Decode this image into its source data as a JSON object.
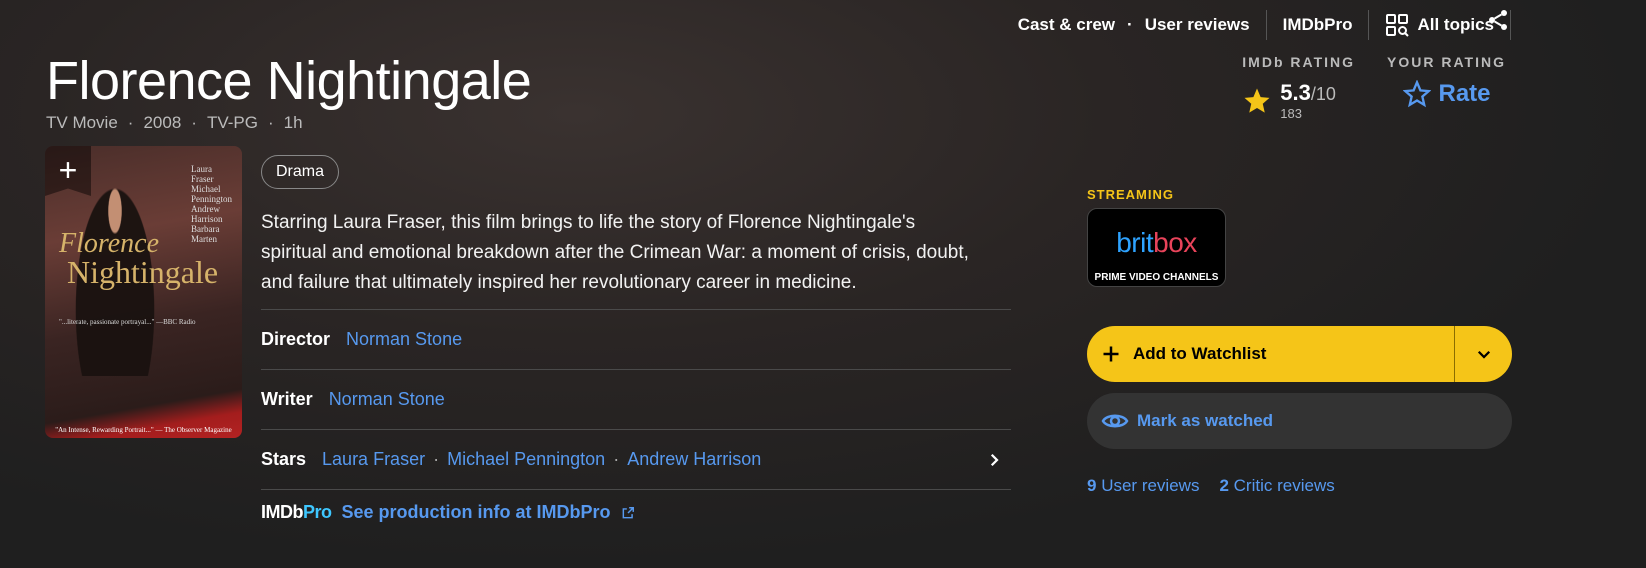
{
  "nav": {
    "cast_crew": "Cast & crew",
    "user_reviews": "User reviews",
    "imdbpro": "IMDbPro",
    "all_topics": "All topics"
  },
  "title": "Florence Nightingale",
  "meta": [
    "TV Movie",
    "2008",
    "TV-PG",
    "1h"
  ],
  "rating": {
    "imdb_label": "IMDb RATING",
    "score": "5.3",
    "out_of": "/10",
    "votes": "183",
    "your_label": "YOUR RATING",
    "rate": "Rate"
  },
  "poster": {
    "cast": [
      "Laura",
      "Fraser",
      "Michael",
      "Pennington",
      "Andrew",
      "Harrison",
      "Barbara",
      "Marten"
    ],
    "title1": "Florence",
    "title2": "Nightingale",
    "quote1": "\"...literate, passionate portrayal...\" —BBC Radio",
    "quote2": "\"An Intense, Rewarding Portrait...\" — The Observer Magazine"
  },
  "genre": "Drama",
  "plot": "Starring Laura Fraser, this film brings to life the story of Florence Nightingale's spiritual and emotional breakdown after the Crimean War: a moment of crisis, doubt, and failure that ultimately inspired her revolutionary career in medicine.",
  "credits": {
    "director_label": "Director",
    "director": "Norman Stone",
    "writer_label": "Writer",
    "writer": "Norman Stone",
    "stars_label": "Stars",
    "stars": [
      "Laura Fraser",
      "Michael Pennington",
      "Andrew Harrison"
    ]
  },
  "imdbpro_link": {
    "logo_imdb": "IMDb",
    "logo_pro": "Pro",
    "text": "See production info at IMDbPro"
  },
  "streaming": {
    "label": "STREAMING",
    "logo_brit": "brit",
    "logo_box": "box",
    "sub": "PRIME VIDEO CHANNELS"
  },
  "actions": {
    "watchlist": "Add to Watchlist",
    "watched": "Mark as watched"
  },
  "reviews": {
    "user_count": "9",
    "user_label": "User reviews",
    "critic_count": "2",
    "critic_label": "Critic reviews"
  },
  "colors": {
    "accent": "#f5c518",
    "link": "#5799ef"
  }
}
